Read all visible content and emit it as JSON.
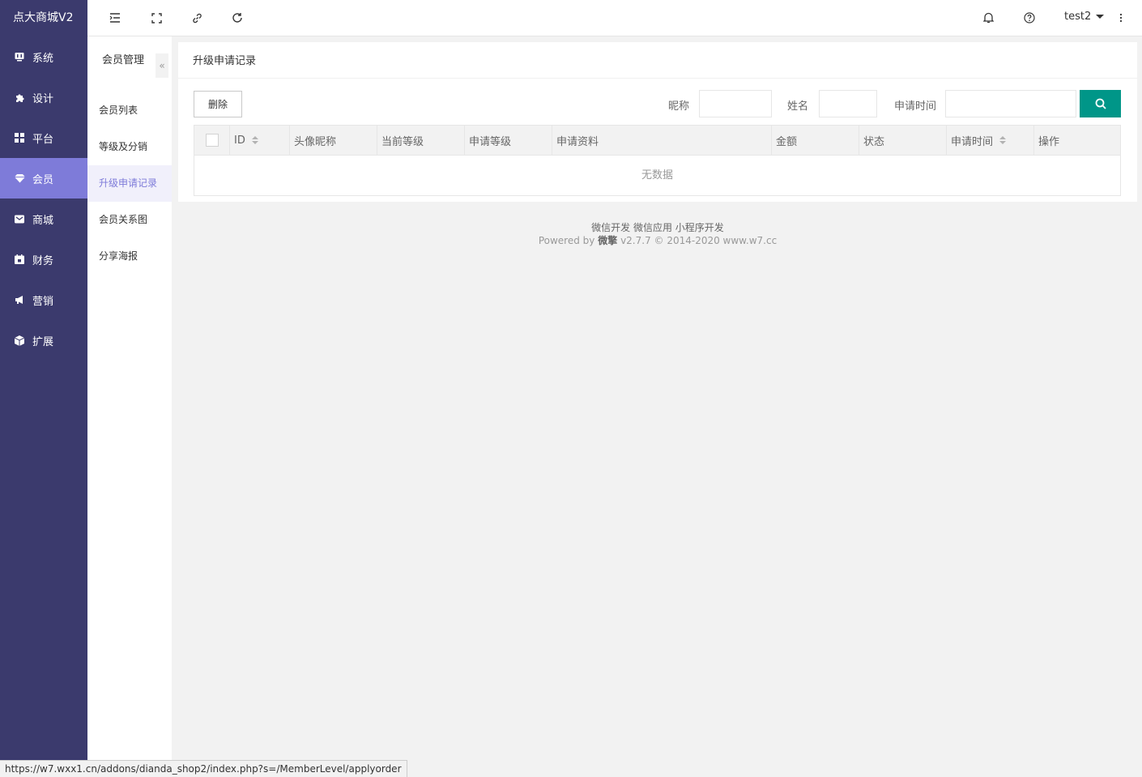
{
  "app": {
    "brand": "点大商城V2"
  },
  "sidebar": {
    "items": [
      {
        "label": "系统",
        "icon": "monitor-icon"
      },
      {
        "label": "设计",
        "icon": "puzzle-icon"
      },
      {
        "label": "平台",
        "icon": "grid-icon"
      },
      {
        "label": "会员",
        "icon": "diamond-icon",
        "active": true
      },
      {
        "label": "商城",
        "icon": "mail-icon"
      },
      {
        "label": "财务",
        "icon": "calendar-icon"
      },
      {
        "label": "营销",
        "icon": "megaphone-icon"
      },
      {
        "label": "扩展",
        "icon": "cube-icon"
      }
    ]
  },
  "topbar": {
    "user": "test2",
    "icons": [
      "menu-icon",
      "fullscreen-icon",
      "link-icon",
      "refresh-icon",
      "bell-icon",
      "help-icon",
      "more-icon"
    ]
  },
  "subnav": {
    "title": "会员管理",
    "collapse": "«",
    "items": [
      {
        "label": "会员列表"
      },
      {
        "label": "等级及分销"
      },
      {
        "label": "升级申请记录",
        "active": true
      },
      {
        "label": "会员关系图"
      },
      {
        "label": "分享海报"
      }
    ]
  },
  "main": {
    "title": "升级申请记录",
    "delete_label": "删除",
    "filters": {
      "nickname_label": "昵称",
      "name_label": "姓名",
      "time_label": "申请时间"
    },
    "table": {
      "columns": [
        "ID",
        "头像昵称",
        "当前等级",
        "申请等级",
        "申请资料",
        "金额",
        "状态",
        "申请时间",
        "操作"
      ],
      "empty": "无数据"
    }
  },
  "footer": {
    "links": "微信开发 微信应用 小程序开发",
    "powered_prefix": "Powered by",
    "powered_brand": "微擎",
    "powered_suffix": "v2.7.7 © 2014-2020 www.w7.cc"
  },
  "statusbar": {
    "url": "https://w7.wxx1.cn/addons/dianda_shop2/index.php?s=/MemberLevel/applyorder"
  },
  "colors": {
    "sidebar": "#3b3a6d",
    "active": "#7e7bd9",
    "search": "#009688"
  }
}
